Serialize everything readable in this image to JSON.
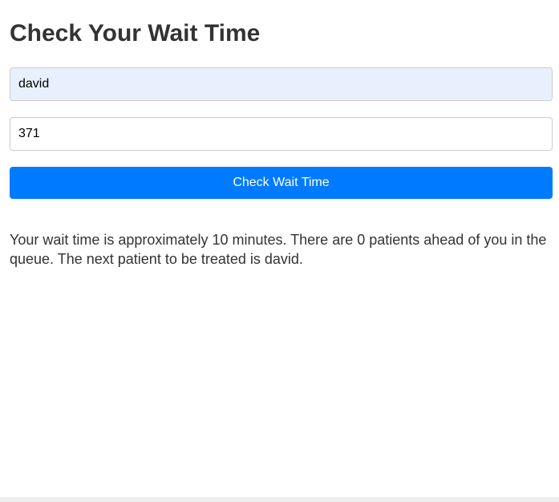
{
  "page": {
    "title": "Check Your Wait Time"
  },
  "form": {
    "name_value": "david",
    "number_value": "371",
    "submit_label": "Check Wait Time"
  },
  "result": {
    "message": "Your wait time is approximately 10 minutes. There are 0 patients ahead of you in the queue. The next patient to be treated is david."
  },
  "colors": {
    "button_background": "#007bff",
    "button_text": "#ffffff",
    "autofill_background": "#e8f0fe",
    "text": "#333333"
  }
}
